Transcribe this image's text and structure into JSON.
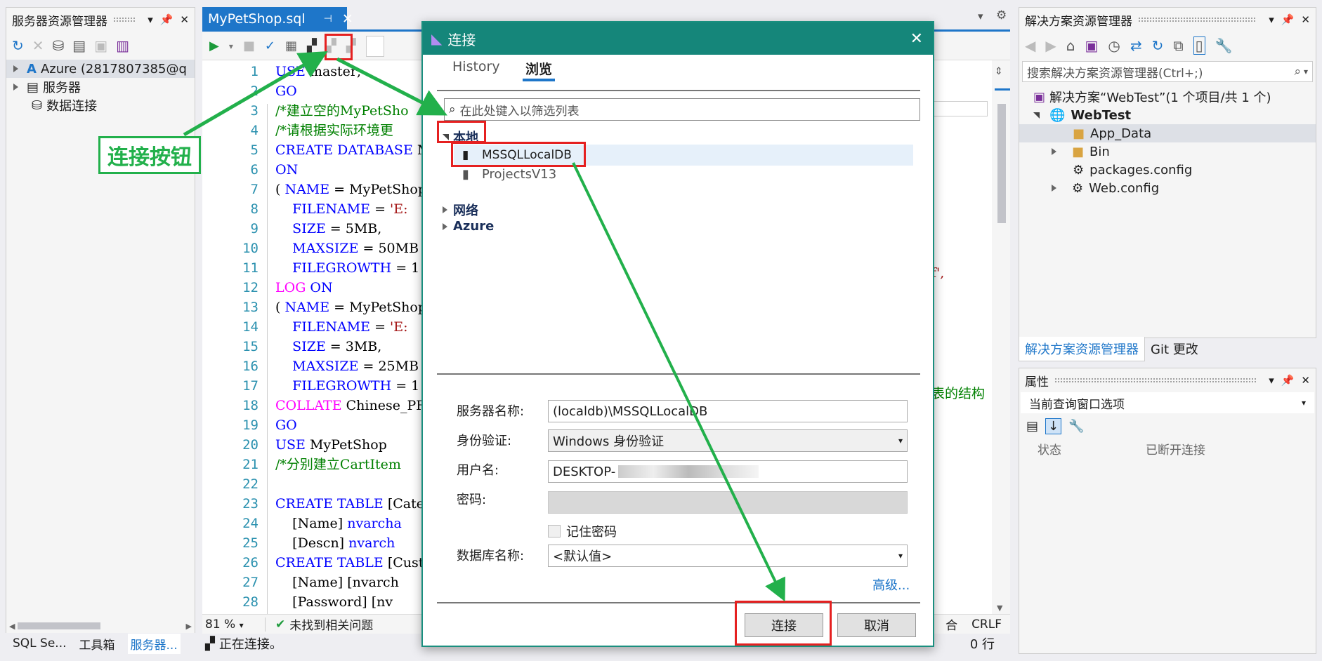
{
  "left_panel": {
    "title": "服务器资源管理器",
    "tree": [
      {
        "label": "Azure (2817807385@q"
      },
      {
        "label": "服务器"
      },
      {
        "label": "数据连接"
      }
    ],
    "bottom_tabs": [
      "SQL Se...",
      "工具箱",
      "服务器..."
    ]
  },
  "editor": {
    "tab_title": "MyPetShop.sql",
    "zoom": "81 %",
    "issues": "未找到相关问题",
    "encoding_tail": "合",
    "line_ending": "CRLF",
    "status": "正在连接。",
    "row_info": "0 行",
    "line_numbers": [
      "1",
      "2",
      "3",
      "4",
      "5",
      "6",
      "7",
      "8",
      "9",
      "10",
      "11",
      "12",
      "13",
      "14",
      "15",
      "16",
      "17",
      "18",
      "19",
      "20",
      "21",
      "22",
      "23",
      "24",
      "25",
      "26",
      "27",
      "28"
    ],
    "right_fragments": {
      "l14": "f',",
      "l21": "表的结构"
    }
  },
  "annotation": {
    "label": "连接按钮"
  },
  "right_panel": {
    "title": "解决方案资源管理器",
    "search_placeholder": "搜索解决方案资源管理器(Ctrl+;)",
    "tree": [
      {
        "label": "解决方案“WebTest”(1 个项目/共 1 个)"
      },
      {
        "label": "WebTest"
      },
      {
        "label": "App_Data"
      },
      {
        "label": "Bin"
      },
      {
        "label": "packages.config"
      },
      {
        "label": "Web.config"
      }
    ],
    "tabs": [
      "解决方案资源管理器",
      "Git 更改"
    ]
  },
  "properties": {
    "title": "属性",
    "selector": "当前查询窗口选项",
    "row_name": "状态",
    "row_value": "已断开连接"
  },
  "dialog": {
    "title": "连接",
    "tabs": [
      "History",
      "浏览"
    ],
    "filter_placeholder": "在此处键入以筛选列表",
    "local_group": "本地",
    "local_items": [
      "MSSQLLocalDB",
      "ProjectsV13"
    ],
    "groups": [
      "网络",
      "Azure"
    ],
    "server_label": "服务器名称:",
    "server_value": "(localdb)\\MSSQLLocalDB",
    "auth_label": "身份验证:",
    "auth_value": "Windows 身份验证",
    "user_label": "用户名:",
    "user_value": "DESKTOP-",
    "password_label": "密码:",
    "remember_label": "记住密码",
    "db_label": "数据库名称:",
    "db_value": "<默认值>",
    "advanced": "高级...",
    "connect": "连接",
    "cancel": "取消"
  }
}
